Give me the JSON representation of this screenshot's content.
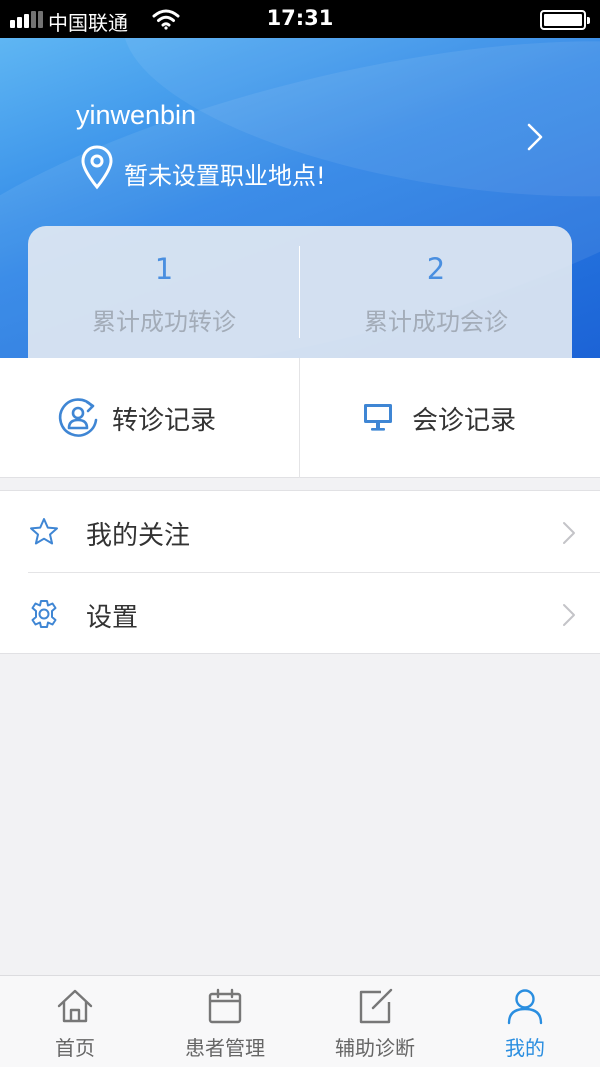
{
  "status_bar": {
    "carrier": "中国联通",
    "time": "17:31",
    "icons": [
      "signal-icon",
      "wifi-icon",
      "battery-icon"
    ]
  },
  "profile": {
    "username": "yinwenbin",
    "location": "暂未设置职业地点!",
    "icons": [
      "location-pin-icon",
      "chevron-right-icon"
    ]
  },
  "stats": [
    {
      "value": "1",
      "label": "累计成功转诊"
    },
    {
      "value": "2",
      "label": "累计成功会诊"
    }
  ],
  "actions": [
    {
      "label": "转诊记录",
      "icon": "referral-record-icon"
    },
    {
      "label": "会诊记录",
      "icon": "monitor-icon"
    }
  ],
  "menu": [
    {
      "label": "我的关注",
      "icon": "star-icon"
    },
    {
      "label": "设置",
      "icon": "gear-icon"
    }
  ],
  "tabbar": {
    "active": "我的",
    "tabs": [
      {
        "label": "首页",
        "icon": "home-icon"
      },
      {
        "label": "患者管理",
        "icon": "calendar-icon"
      },
      {
        "label": "辅助诊断",
        "icon": "edit-icon"
      },
      {
        "label": "我的",
        "icon": "person-icon"
      }
    ]
  },
  "colors": {
    "header_gradient_start": "#5fb6f3",
    "header_gradient_end": "#1c63d6",
    "accent": "#2a8ee0",
    "stat_number": "#4a8fe0",
    "stat_label": "#a3acb8",
    "icon_blue": "#3f86d4"
  }
}
